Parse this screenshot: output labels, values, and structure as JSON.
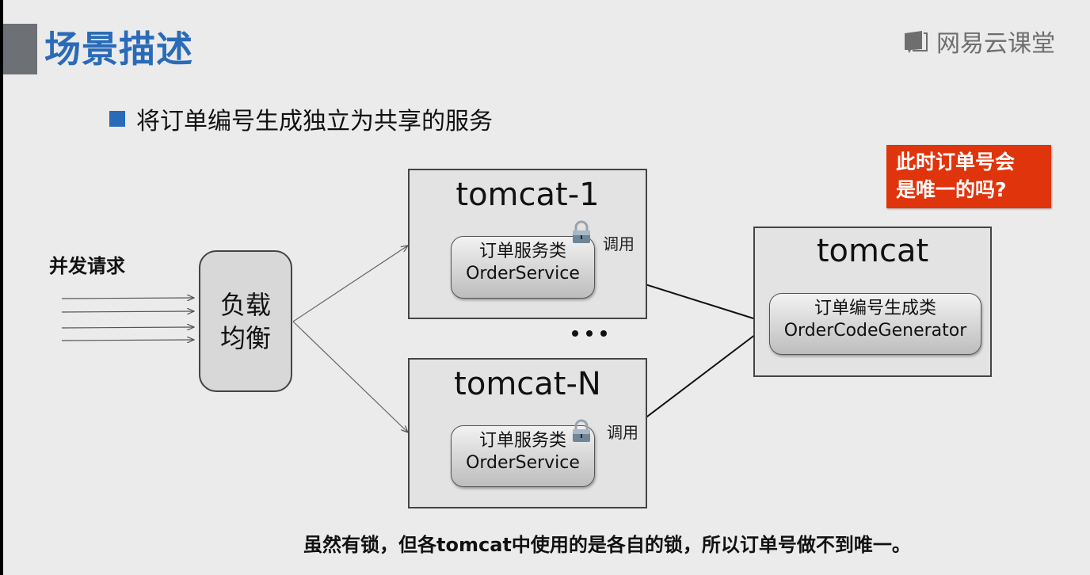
{
  "header": {
    "title": "场景描述",
    "brand": "网易云课堂",
    "title_color": "#2a6bb8"
  },
  "bullet": {
    "text": "将订单编号生成独立为共享的服务"
  },
  "callout": {
    "line1": "此时订单号会",
    "line2": "是唯一的吗?",
    "color": "#e0340c"
  },
  "diagram": {
    "requests_label": "并发请求",
    "load_balancer": {
      "line1": "负载",
      "line2": "均衡"
    },
    "servers": [
      {
        "title": "tomcat-1",
        "service_cn": "订单服务类",
        "service_en": "OrderService",
        "call_label": "调用"
      },
      {
        "title": "tomcat-N",
        "service_cn": "订单服务类",
        "service_en": "OrderService",
        "call_label": "调用"
      }
    ],
    "shared": {
      "title": "tomcat",
      "service_cn": "订单编号生成类",
      "service_en": "OrderCodeGenerator"
    }
  },
  "footer": {
    "text": "虽然有锁，但各tomcat中使用的是各自的锁，所以订单号做不到唯一。"
  }
}
